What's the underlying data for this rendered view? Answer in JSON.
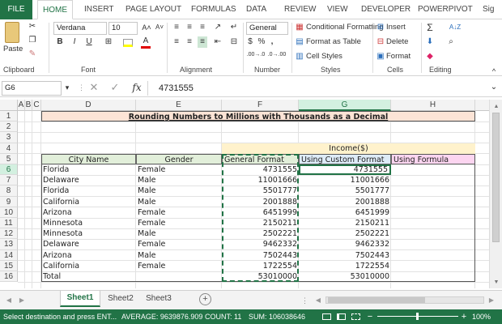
{
  "ribbon_tabs": [
    "FILE",
    "HOME",
    "INSERT",
    "PAGE LAYOUT",
    "FORMULAS",
    "DATA",
    "REVIEW",
    "VIEW",
    "DEVELOPER",
    "POWERPIVOT",
    "Sig"
  ],
  "clipboard": {
    "paste": "Paste",
    "label": "Clipboard"
  },
  "font": {
    "name": "Verdana",
    "size": "10",
    "label": "Font",
    "bold": "B",
    "italic": "I",
    "underline": "U",
    "grow": "A˄",
    "shrink": "A˅",
    "font_color_glyph": "A"
  },
  "alignment": {
    "label": "Alignment"
  },
  "number": {
    "format": "General",
    "label": "Number",
    "currency": "$",
    "percent": "%",
    "comma": ",",
    "inc_dec": ".00→.0",
    "dec_dec": ".0→.00"
  },
  "styles": {
    "conditional": "Conditional Formatting",
    "table": "Format as Table",
    "cell_styles": "Cell Styles",
    "label": "Styles"
  },
  "cells": {
    "insert": "Insert",
    "delete": "Delete",
    "format": "Format",
    "label": "Cells"
  },
  "editing": {
    "label": "Editing",
    "sum": "Σ",
    "sort": "A↓Z"
  },
  "formula_bar": {
    "name_box": "G6",
    "cancel": "✕",
    "enter": "✓",
    "fx": "fx",
    "value": "4731555"
  },
  "columns": [
    "A",
    "B",
    "C",
    "D",
    "E",
    "F",
    "G",
    "H"
  ],
  "rows": [
    "1",
    "2",
    "3",
    "4",
    "5",
    "6",
    "7",
    "8",
    "9",
    "10",
    "11",
    "12",
    "13",
    "14",
    "15",
    "16"
  ],
  "sheet": {
    "title": "Rounding Numbers to Millions with Thousands as a Decimal",
    "income_header": "Income($)",
    "headers": [
      "City Name",
      "Gender",
      "General Format",
      "Using Custom Format",
      "Using Formula"
    ],
    "data": [
      [
        "Florida",
        "Female",
        "4731555",
        "4731555"
      ],
      [
        "Delaware",
        "Male",
        "11001666",
        "11001666"
      ],
      [
        "Florida",
        "Male",
        "5501777",
        "5501777"
      ],
      [
        "California",
        "Male",
        "2001888",
        "2001888"
      ],
      [
        "Arizona",
        "Female",
        "6451999",
        "6451999"
      ],
      [
        "Minnesota",
        "Female",
        "2150211",
        "2150211"
      ],
      [
        "Minnesota",
        "Male",
        "2502221",
        "2502221"
      ],
      [
        "Delaware",
        "Female",
        "9462332",
        "9462332"
      ],
      [
        "Arizona",
        "Male",
        "7502443",
        "7502443"
      ],
      [
        "California",
        "Female",
        "1722554",
        "1722554"
      ]
    ],
    "total_label": "Total",
    "totals": [
      "53010000",
      "53010000"
    ]
  },
  "sheet_tabs": [
    "Sheet1",
    "Sheet2",
    "Sheet3"
  ],
  "add_sheet": "+",
  "status_bar": {
    "message": "Select destination and press ENT...",
    "average": "AVERAGE: 9639876.909",
    "count": "COUNT: 11",
    "sum": "SUM: 106038646",
    "zoom": "100%"
  },
  "colors": {
    "accent": "#217346",
    "title_fill": "#fce4d6",
    "income_fill": "#fff2cc",
    "header_green": "#e2efda",
    "header_blue": "#ddebf7",
    "header_pink": "#fcd5f0"
  }
}
